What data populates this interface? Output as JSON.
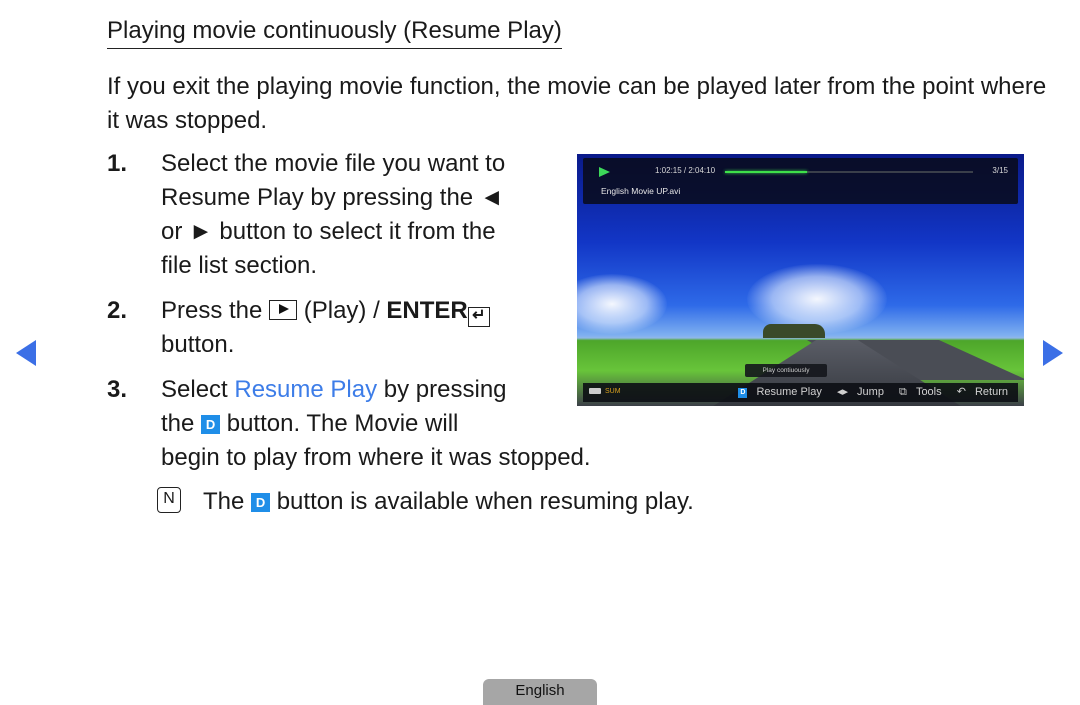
{
  "title": "Playing movie continuously (Resume Play)",
  "intro": "If you exit the playing movie function, the movie can be played later from the point where it was stopped.",
  "steps": [
    {
      "num": "1.",
      "lines": [
        "Select the movie file you want to",
        "Resume Play by pressing the ◄",
        "or ► button to select it from the",
        "file list section."
      ]
    },
    {
      "num": "2.",
      "line1_prefix": "Press the",
      "line1_play": "(Play) /",
      "line1_enter": "ENTER",
      "enter_glyph": "↵",
      "line2": "button."
    },
    {
      "num": "3.",
      "line1_prefix": "Select",
      "line1_highlight": "Resume Play",
      "line1_suffix": "by pressing",
      "line2_prefix": "the",
      "d_button": "D",
      "line2_suffix": "button. The Movie will",
      "line3": "begin to play from where it was stopped."
    }
  ],
  "note": {
    "icon": "N",
    "prefix": "The",
    "d_button": "D",
    "suffix": "button is available when resuming play."
  },
  "screen": {
    "time": "1:02:15 / 2:04:10",
    "progress_percent": 33,
    "count": "3/15",
    "filename": "English Movie UP.avi",
    "tooltip": "Play contiuously",
    "device_label": "SUM",
    "d_button": "D",
    "actions": {
      "resume": "Resume Play",
      "jump_icon": "◂▸",
      "jump": "Jump",
      "tools": "Tools",
      "return_icon": "↶",
      "return": "Return"
    }
  },
  "nav": {
    "prev": "previous-page",
    "next": "next-page"
  },
  "footer": {
    "language": "English"
  },
  "colors": {
    "accent_blue": "#3d7de8",
    "d_button": "#1f8ee8",
    "nav_arrow": "#3b6fe6",
    "progress": "#3ee04a"
  }
}
